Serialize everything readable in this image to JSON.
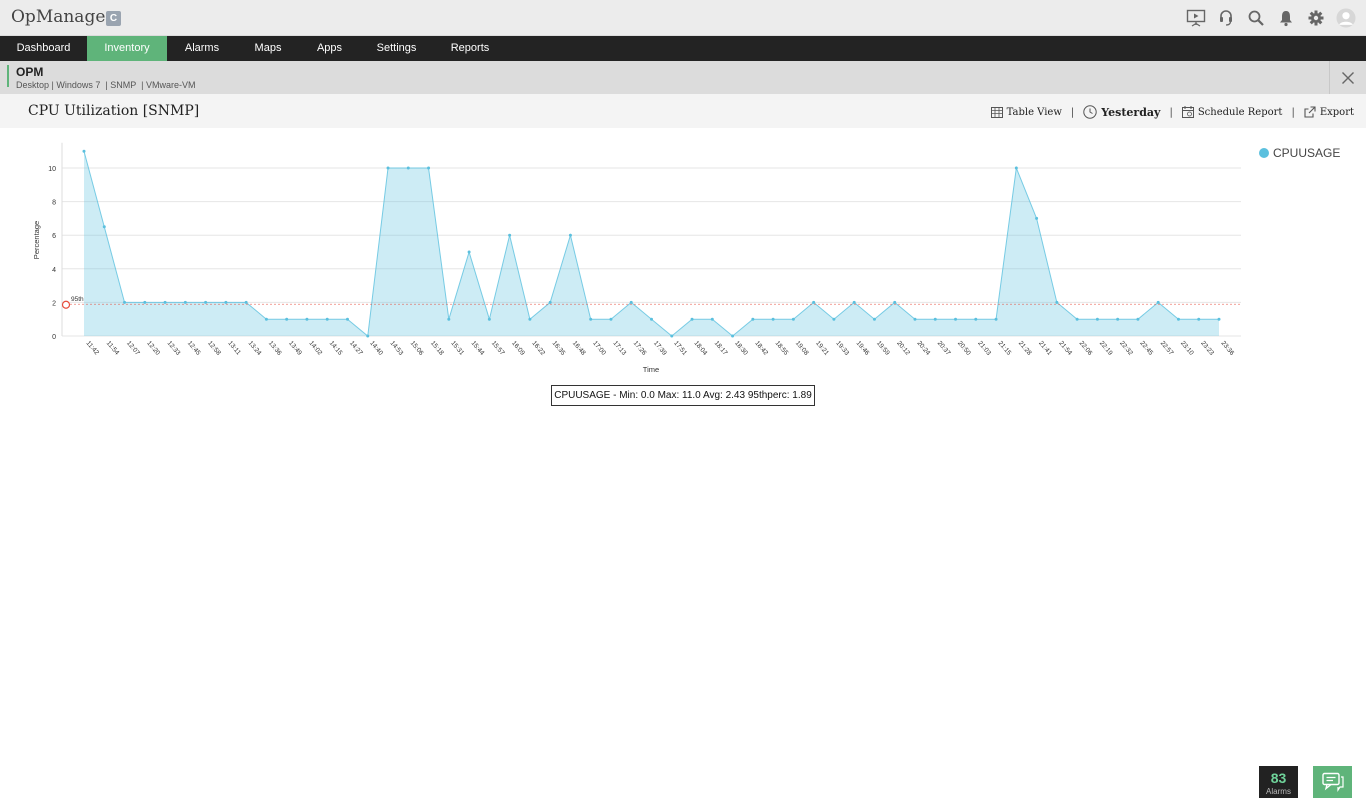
{
  "app": {
    "title": "OpManager",
    "edition_badge": "C"
  },
  "top_icons": [
    "presentation-icon",
    "support-icon",
    "search-icon",
    "bell-icon",
    "gear-icon",
    "user-avatar-icon"
  ],
  "nav": {
    "items": [
      "Dashboard",
      "Inventory",
      "Alarms",
      "Maps",
      "Apps",
      "Settings",
      "Reports"
    ],
    "active": "Inventory"
  },
  "device": {
    "name": "OPM",
    "tags": [
      "Desktop",
      "Windows 7",
      "SNMP",
      "VMware-VM"
    ]
  },
  "page": {
    "title": "CPU Utilization [SNMP]"
  },
  "actions": {
    "table_view": "Table View",
    "period": "Yesterday",
    "schedule_report": "Schedule Report",
    "export": "Export"
  },
  "colors": {
    "accent": "#5fb47a",
    "nav_bg": "#232323",
    "series": "#5bc0de",
    "threshold": "#e74c3c"
  },
  "chart_data": {
    "type": "area",
    "xlabel": "Time",
    "ylabel": "Percentage",
    "ylim": [
      0,
      11
    ],
    "yticks": [
      0,
      2,
      4,
      6,
      8,
      10
    ],
    "grid": true,
    "legend_position": "top-right",
    "x": [
      "11:42",
      "11:54",
      "12:07",
      "12:20",
      "12:33",
      "12:45",
      "12:58",
      "13:11",
      "13:24",
      "13:36",
      "13:49",
      "14:02",
      "14:15",
      "14:27",
      "14:40",
      "14:53",
      "15:06",
      "15:18",
      "15:31",
      "15:44",
      "15:57",
      "16:09",
      "16:22",
      "16:35",
      "16:48",
      "17:00",
      "17:13",
      "17:26",
      "17:39",
      "17:51",
      "18:04",
      "18:17",
      "18:30",
      "18:42",
      "18:55",
      "19:08",
      "19:21",
      "19:33",
      "19:46",
      "19:59",
      "20:12",
      "20:24",
      "20:37",
      "20:50",
      "21:03",
      "21:15",
      "21:28",
      "21:41",
      "21:54",
      "22:06",
      "22:19",
      "22:32",
      "22:45",
      "22:57",
      "23:10",
      "23:23",
      "23:36"
    ],
    "series": [
      {
        "name": "CPUUSAGE",
        "values": [
          11,
          6.5,
          2,
          2,
          2,
          2,
          2,
          2,
          2,
          1,
          1,
          1,
          1,
          1,
          0,
          10,
          10,
          10,
          1,
          5,
          1,
          6,
          1,
          2,
          6,
          1,
          1,
          2,
          1,
          0,
          1,
          1,
          0,
          1,
          1,
          1,
          2,
          1,
          2,
          1,
          2,
          1,
          1,
          1,
          1,
          1,
          10,
          7,
          2,
          1,
          1,
          1,
          1,
          2,
          1,
          1,
          1
        ]
      }
    ],
    "threshold": {
      "label": "95th",
      "value": 1.89
    },
    "summary": "CPUUSAGE - Min: 0.0 Max: 11.0 Avg: 2.43 95thperc: 1.89"
  },
  "footer": {
    "alarms_count": "83",
    "alarms_label": "Alarms"
  }
}
